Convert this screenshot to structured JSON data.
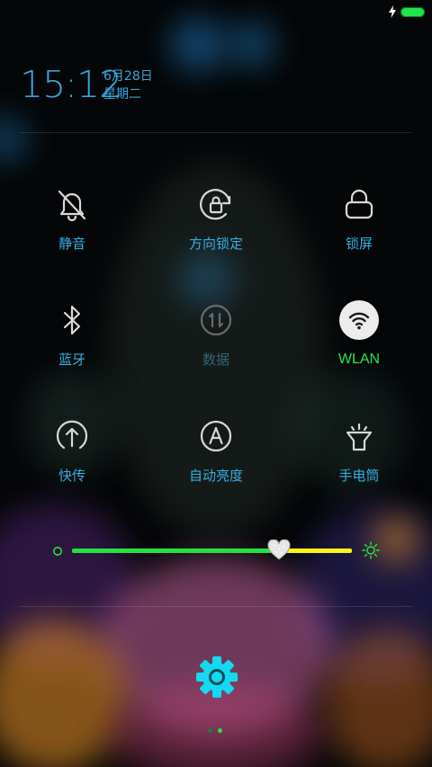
{
  "status_bar": {
    "charging_icon": "lightning-bolt-icon",
    "battery_icon": "battery-full-icon",
    "battery_color": "#21e34b"
  },
  "clock": {
    "time": "15:12",
    "date": "6月28日",
    "weekday": "星期二"
  },
  "toggles": [
    {
      "label": "静音",
      "icon": "bell-off-icon",
      "state": "off"
    },
    {
      "label": "方向锁定",
      "icon": "rotation-lock-icon",
      "state": "off"
    },
    {
      "label": "锁屏",
      "icon": "lock-icon",
      "state": "off"
    },
    {
      "label": "蓝牙",
      "icon": "bluetooth-icon",
      "state": "off"
    },
    {
      "label": "数据",
      "icon": "mobile-data-icon",
      "state": "disabled"
    },
    {
      "label": "WLAN",
      "icon": "wifi-icon",
      "state": "on"
    },
    {
      "label": "快传",
      "icon": "quick-transfer-icon",
      "state": "off"
    },
    {
      "label": "自动亮度",
      "icon": "auto-brightness-icon",
      "state": "off"
    },
    {
      "label": "手电筒",
      "icon": "flashlight-icon",
      "state": "off"
    }
  ],
  "brightness": {
    "level": 0.74,
    "low_icon": "brightness-low-icon",
    "high_icon": "sun-icon",
    "thumb_icon": "heart-icon"
  },
  "settings": {
    "icon": "gear-icon",
    "color": "#14d9f0"
  },
  "pager": {
    "pages": 2,
    "active": 2
  },
  "colors": {
    "accent": "#38aee3",
    "active": "#27e54a",
    "disabled": "#34667e",
    "track_fill": "#27e23e",
    "track_rest": "#fff514"
  }
}
